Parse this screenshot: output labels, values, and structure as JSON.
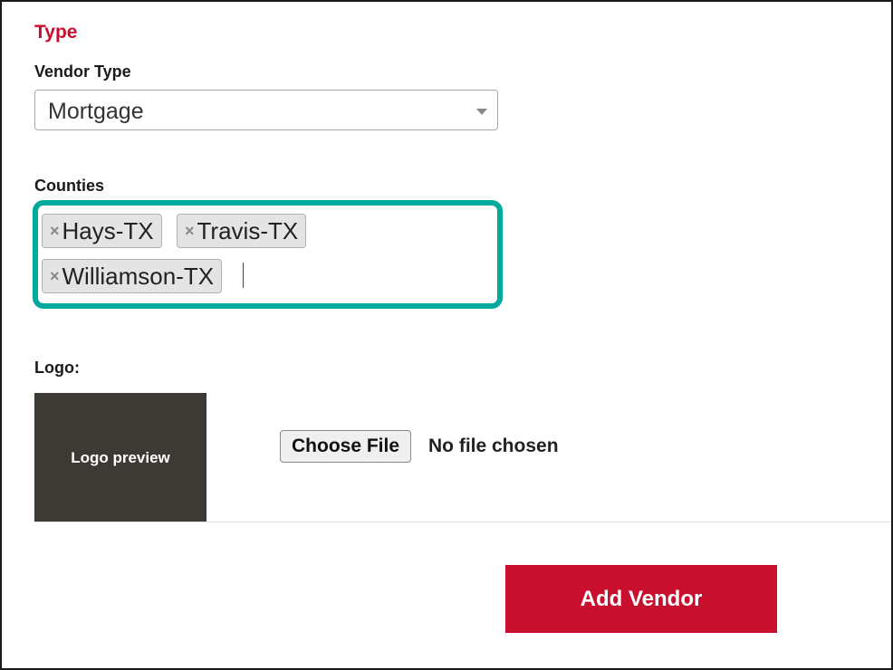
{
  "section": {
    "title": "Type"
  },
  "vendor_type": {
    "label": "Vendor Type",
    "selected": "Mortgage"
  },
  "counties": {
    "label": "Counties",
    "tags": [
      "Hays-TX",
      "Travis-TX",
      "Williamson-TX"
    ],
    "remove_glyph": "×"
  },
  "logo": {
    "label": "Logo:",
    "preview_text": "Logo preview",
    "choose_file_label": "Choose File",
    "file_status": "No file chosen"
  },
  "actions": {
    "add_vendor_label": "Add Vendor"
  },
  "colors": {
    "accent_red": "#c8102e",
    "highlight_teal": "#00a99d",
    "logo_preview_bg": "#3d3935"
  }
}
